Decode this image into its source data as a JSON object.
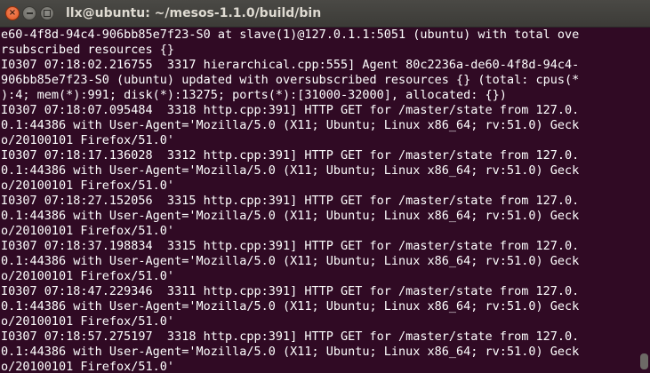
{
  "window": {
    "title": "llx@ubuntu: ~/mesos-1.1.0/build/bin",
    "close_glyph": "×"
  },
  "terminal": {
    "lines": [
      "e60-4f8d-94c4-906bb85e7f23-S0 at slave(1)@127.0.1.1:5051 (ubuntu) with total ove",
      "rsubscribed resources {}",
      "I0307 07:18:02.216755  3317 hierarchical.cpp:555] Agent 80c2236a-de60-4f8d-94c4-",
      "906bb85e7f23-S0 (ubuntu) updated with oversubscribed resources {} (total: cpus(*",
      "):4; mem(*):991; disk(*):13275; ports(*):[31000-32000], allocated: {})",
      "I0307 07:18:07.095484  3318 http.cpp:391] HTTP GET for /master/state from 127.0.",
      "0.1:44386 with User-Agent='Mozilla/5.0 (X11; Ubuntu; Linux x86_64; rv:51.0) Geck",
      "o/20100101 Firefox/51.0'",
      "I0307 07:18:17.136028  3312 http.cpp:391] HTTP GET for /master/state from 127.0.",
      "0.1:44386 with User-Agent='Mozilla/5.0 (X11; Ubuntu; Linux x86_64; rv:51.0) Geck",
      "o/20100101 Firefox/51.0'",
      "I0307 07:18:27.152056  3315 http.cpp:391] HTTP GET for /master/state from 127.0.",
      "0.1:44386 with User-Agent='Mozilla/5.0 (X11; Ubuntu; Linux x86_64; rv:51.0) Geck",
      "o/20100101 Firefox/51.0'",
      "I0307 07:18:37.198834  3315 http.cpp:391] HTTP GET for /master/state from 127.0.",
      "0.1:44386 with User-Agent='Mozilla/5.0 (X11; Ubuntu; Linux x86_64; rv:51.0) Geck",
      "o/20100101 Firefox/51.0'",
      "I0307 07:18:47.229346  3311 http.cpp:391] HTTP GET for /master/state from 127.0.",
      "0.1:44386 with User-Agent='Mozilla/5.0 (X11; Ubuntu; Linux x86_64; rv:51.0) Geck",
      "o/20100101 Firefox/51.0'",
      "I0307 07:18:57.275197  3318 http.cpp:391] HTTP GET for /master/state from 127.0.",
      "0.1:44386 with User-Agent='Mozilla/5.0 (X11; Ubuntu; Linux x86_64; rv:51.0) Geck",
      "o/20100101 Firefox/51.0'"
    ]
  },
  "colors": {
    "background": "#300a24",
    "text": "#ffffff",
    "titlebar": "#3c3b37",
    "close_button": "#e0531b"
  },
  "icons": {
    "close": "close-icon",
    "minimize": "minimize-icon",
    "maximize": "maximize-icon"
  }
}
